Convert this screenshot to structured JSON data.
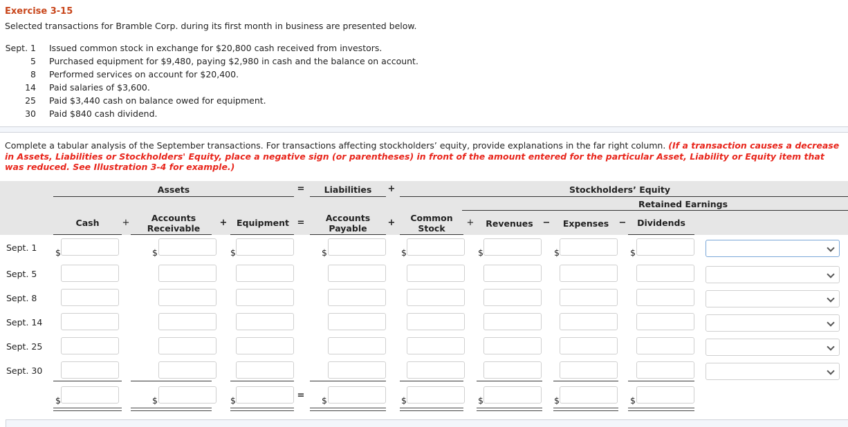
{
  "exercise": {
    "title": "Exercise 3-15",
    "intro": "Selected transactions for Bramble Corp. during its first month in business are presented below."
  },
  "transactions": [
    {
      "date": "Sept. 1",
      "desc": "Issued common stock in exchange for $20,800 cash received from investors."
    },
    {
      "date": "5",
      "desc": "Purchased equipment for $9,480, paying $2,980 in cash and the balance on account."
    },
    {
      "date": "8",
      "desc": "Performed services on account for $20,400."
    },
    {
      "date": "14",
      "desc": "Paid salaries of $3,600."
    },
    {
      "date": "25",
      "desc": "Paid $3,440 cash on balance owed for equipment."
    },
    {
      "date": "30",
      "desc": "Paid $840 cash dividend."
    }
  ],
  "instructions": {
    "text": "Complete a tabular analysis of the September transactions. For transactions affecting stockholders’ equity, provide explanations in the far right column. ",
    "emphasis": "(If a transaction causes a decrease in Assets, Liabilities or Stockholders' Equity, place a negative sign (or parentheses) in front of the amount entered for the particular Asset, Liability or Equity item that was reduced. See Illustration 3-4 for example.)"
  },
  "table": {
    "groups": {
      "assets": "Assets",
      "eq1": "=",
      "liabilities": "Liabilities",
      "plus1": "+",
      "equity": "Stockholders’ Equity",
      "retained": "Retained Earnings"
    },
    "columns": {
      "cash": "Cash",
      "ar_line1": "Accounts",
      "ar_line2": "Receivable",
      "equipment": "Equipment",
      "ap_line1": "Accounts",
      "ap_line2": "Payable",
      "cs_line1": "Common",
      "cs_line2": "Stock",
      "revenues": "Revenues",
      "expenses": "Expenses",
      "dividends": "Dividends"
    },
    "operators": {
      "plus": "+",
      "equals": "=",
      "minus": "−"
    },
    "currency_symbol": "$",
    "rows": [
      {
        "label": "Sept. 1",
        "values": [
          "",
          "",
          "",
          "",
          "",
          "",
          "",
          ""
        ],
        "explanation": ""
      },
      {
        "label": "Sept. 5",
        "values": [
          "",
          "",
          "",
          "",
          "",
          "",
          "",
          ""
        ],
        "explanation": ""
      },
      {
        "label": "Sept. 8",
        "values": [
          "",
          "",
          "",
          "",
          "",
          "",
          "",
          ""
        ],
        "explanation": ""
      },
      {
        "label": "Sept. 14",
        "values": [
          "",
          "",
          "",
          "",
          "",
          "",
          "",
          ""
        ],
        "explanation": ""
      },
      {
        "label": "Sept. 25",
        "values": [
          "",
          "",
          "",
          "",
          "",
          "",
          "",
          ""
        ],
        "explanation": ""
      },
      {
        "label": "Sept. 30",
        "values": [
          "",
          "",
          "",
          "",
          "",
          "",
          "",
          ""
        ],
        "explanation": ""
      }
    ],
    "totals": [
      "",
      "",
      "",
      "",
      "",
      "",
      "",
      ""
    ]
  }
}
